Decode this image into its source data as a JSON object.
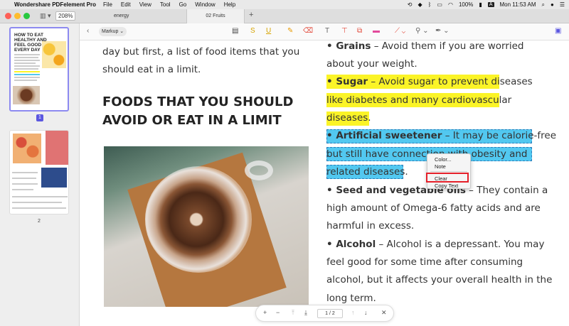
{
  "menubar": {
    "app_name": "Wondershare PDFelement Pro",
    "menus": [
      "File",
      "Edit",
      "View",
      "Tool",
      "Go",
      "Window",
      "Help"
    ],
    "battery": "100%",
    "ime": "A",
    "clock": "Mon 11:53 AM"
  },
  "tabbar": {
    "zoom": "208%",
    "tabs": [
      "energy",
      "02 Fruits"
    ],
    "add_tab": "+"
  },
  "sidebar": {
    "page1_label": "1",
    "page2_label": "2",
    "thumb1_title": "HOW TO EAT HEALTHY AND FEEL GOOD EVERY DAY"
  },
  "toolbar": {
    "markup_label": "Markup",
    "icons": [
      "back-icon",
      "highlight-icon",
      "strikethrough-icon",
      "underline-icon",
      "pencil-icon",
      "eraser-icon",
      "text-icon",
      "textbox-icon",
      "callout-icon",
      "note-icon",
      "shape-icon",
      "stamp-icon",
      "signature-icon",
      "panel-icon"
    ]
  },
  "document": {
    "left": {
      "line1": "day but first, a list of food items that you",
      "line2": "should eat in a limit.",
      "heading1": "FOODS THAT YOU SHOULD",
      "heading2": "AVOID OR EAT IN A LIMIT"
    },
    "right": {
      "grains_bold": "• Grains",
      "grains_rest": " – Avoid them if you are worried",
      "grains_l2": "about your weight.",
      "sugar_bold": "• Sugar",
      "sugar_rest": " – Avoid sugar to prevent diseases",
      "sugar_l2": "like diabetes and many cardiovascular",
      "sugar_l3": "diseases.",
      "sweet_bold": "• Artificial sweetener",
      "sweet_rest": " – It may be calorie-free",
      "sweet_l2": "but still have connection with obesity and",
      "sweet_l3": "related diseases.",
      "seed_bold": "• Seed and vegetable oils",
      "seed_rest": " – They contain a",
      "seed_l2": "high amount of Omega-6 fatty acids and are",
      "seed_l3": "harmful in excess.",
      "alcohol_bold": "• Alcohol",
      "alcohol_rest": " – Alcohol is a depressant. You may",
      "alcohol_l2": "feel good for some time after consuming",
      "alcohol_l3": "alcohol, but it affects your overall health in the",
      "alcohol_l4": "long term."
    }
  },
  "context_menu": {
    "items": [
      "Color...",
      "Note",
      "Clear",
      "Copy Text"
    ]
  },
  "pagebar": {
    "page_value": "1",
    "separator": "/",
    "total": "2"
  },
  "colors": {
    "highlight_yellow": "#fbf427",
    "highlight_blue": "#52c8f0",
    "selection_accent": "#5b57e0",
    "annotation_red": "#e5202a"
  }
}
